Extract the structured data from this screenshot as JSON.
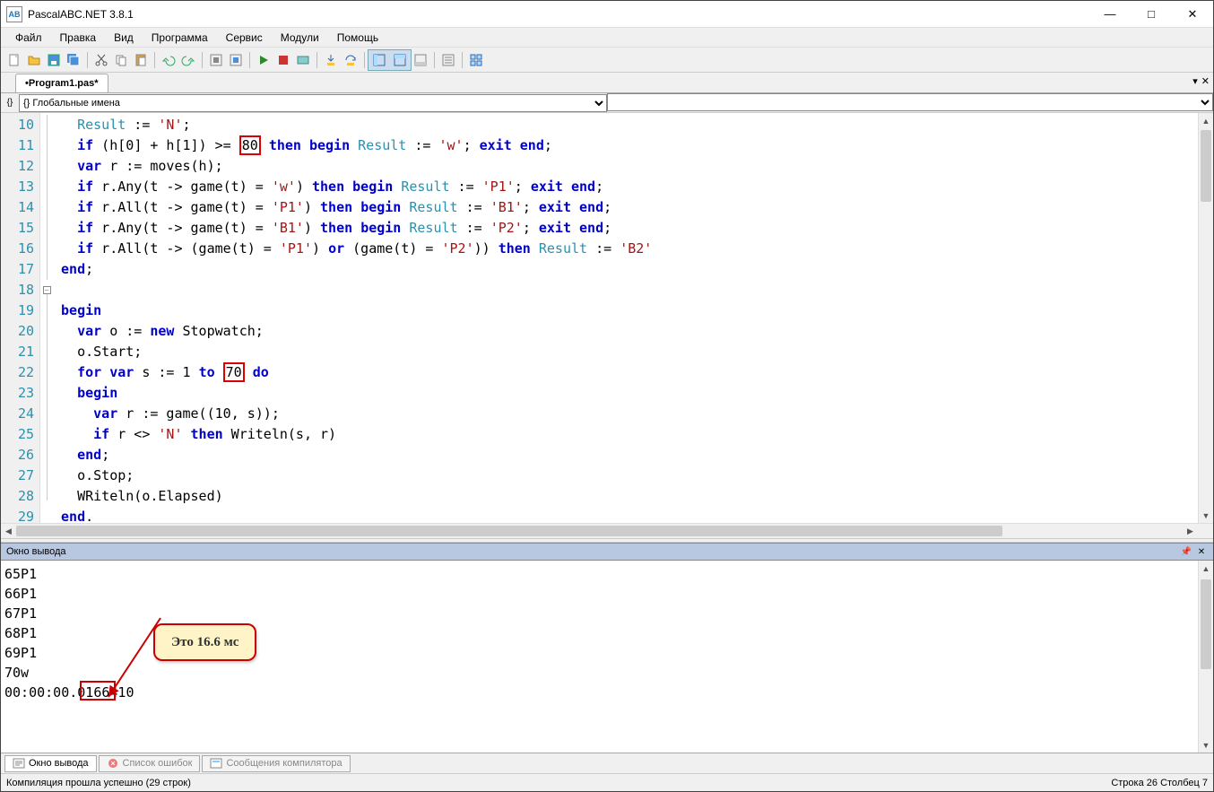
{
  "title": "PascalABC.NET 3.8.1",
  "menu": [
    "Файл",
    "Правка",
    "Вид",
    "Программа",
    "Сервис",
    "Модули",
    "Помощь"
  ],
  "tab": "•Program1.pas*",
  "namespace_left": "{} Глобальные имена",
  "line_numbers": [
    10,
    11,
    12,
    13,
    14,
    15,
    16,
    17,
    18,
    19,
    20,
    21,
    22,
    23,
    24,
    25,
    26,
    27,
    28,
    29
  ],
  "highlights": {
    "val1": "80",
    "val2": "70"
  },
  "output_panel_title": "Окно вывода",
  "output_lines": [
    "65P1",
    "66P1",
    "67P1",
    "68P1",
    "69P1",
    "70w",
    "00:00:00.0166410"
  ],
  "callout_text": "Это 16.6 мс",
  "bottom_tabs": {
    "output": "Окно вывода",
    "errors": "Список ошибок",
    "compiler": "Сообщения компилятора"
  },
  "status_left": "Компиляция прошла успешно (29 строк)",
  "status_right": "Строка  26  Столбец  7"
}
